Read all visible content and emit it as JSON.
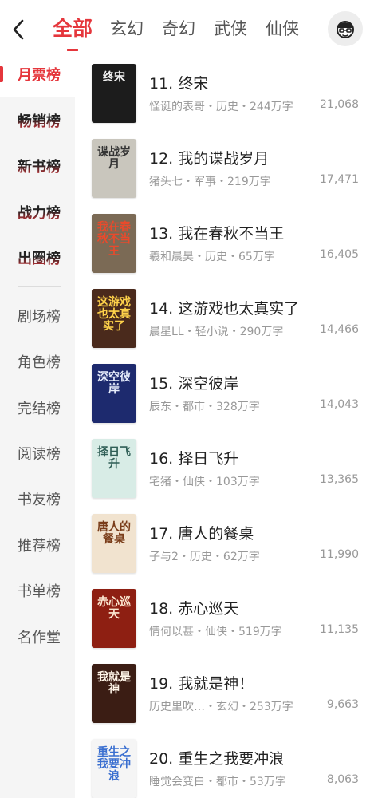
{
  "header": {
    "tabs": [
      {
        "label": "全部",
        "active": true
      },
      {
        "label": "玄幻"
      },
      {
        "label": "奇幻"
      },
      {
        "label": "武侠"
      },
      {
        "label": "仙侠"
      }
    ],
    "accent_color": "#e5363c"
  },
  "sidebar": {
    "items": [
      {
        "label": "月票榜",
        "active": true
      },
      {
        "label": "畅销榜"
      },
      {
        "label": "新书榜"
      },
      {
        "label": "战力榜"
      },
      {
        "label": "出圈榜"
      },
      {
        "label": "剧场榜"
      },
      {
        "label": "角色榜"
      },
      {
        "label": "完结榜"
      },
      {
        "label": "阅读榜"
      },
      {
        "label": "书友榜"
      },
      {
        "label": "推荐榜"
      },
      {
        "label": "书单榜"
      },
      {
        "label": "名作堂"
      }
    ]
  },
  "books": [
    {
      "rank": "11.",
      "title": "终宋",
      "meta": "怪诞的表哥・历史・244万字",
      "count": "21,068",
      "cover_text": "终宋",
      "cover_bg": "#1c1c1c",
      "cover_fg": "#f2f2f2"
    },
    {
      "rank": "12.",
      "title": "我的谍战岁月",
      "meta": "猪头七・军事・219万字",
      "count": "17,471",
      "cover_text": "谍战岁月",
      "cover_bg": "#c9c6bd",
      "cover_fg": "#333333"
    },
    {
      "rank": "13.",
      "title": "我在春秋不当王",
      "meta": "羲和晨昊・历史・65万字",
      "count": "16,405",
      "cover_text": "我在春秋不当王",
      "cover_bg": "#7b6a55",
      "cover_fg": "#e94a2c"
    },
    {
      "rank": "14.",
      "title": "这游戏也太真实了",
      "meta": "晨星LL・轻小说・290万字",
      "count": "14,466",
      "cover_text": "这游戏也太真实了",
      "cover_bg": "#4a2a1c",
      "cover_fg": "#ffd24a"
    },
    {
      "rank": "15.",
      "title": "深空彼岸",
      "meta": "辰东・都市・328万字",
      "count": "14,043",
      "cover_text": "深空彼岸",
      "cover_bg": "#1d2a6e",
      "cover_fg": "#e8eefc"
    },
    {
      "rank": "16.",
      "title": "择日飞升",
      "meta": "宅猪・仙侠・103万字",
      "count": "13,365",
      "cover_text": "择日飞升",
      "cover_bg": "#d8ece6",
      "cover_fg": "#2f5e56"
    },
    {
      "rank": "17.",
      "title": "唐人的餐桌",
      "meta": "子与2・历史・62万字",
      "count": "11,990",
      "cover_text": "唐人的餐桌",
      "cover_bg": "#f1e3cf",
      "cover_fg": "#7a3d1a"
    },
    {
      "rank": "18.",
      "title": "赤心巡天",
      "meta": "情何以甚・仙侠・519万字",
      "count": "11,135",
      "cover_text": "赤心巡天",
      "cover_bg": "#8e1f12",
      "cover_fg": "#fbe7d0"
    },
    {
      "rank": "19.",
      "title": "我就是神！",
      "meta": "历史里吹…・玄幻・253万字",
      "count": "9,663",
      "cover_text": "我就是神",
      "cover_bg": "#3b1d14",
      "cover_fg": "#fff5e8"
    },
    {
      "rank": "20.",
      "title": "重生之我要冲浪",
      "meta": "睡觉会变白・都市・53万字",
      "count": "8,063",
      "cover_text": "重生之我要冲浪",
      "cover_bg": "#f5f5f5",
      "cover_fg": "#3a6fd0"
    }
  ]
}
